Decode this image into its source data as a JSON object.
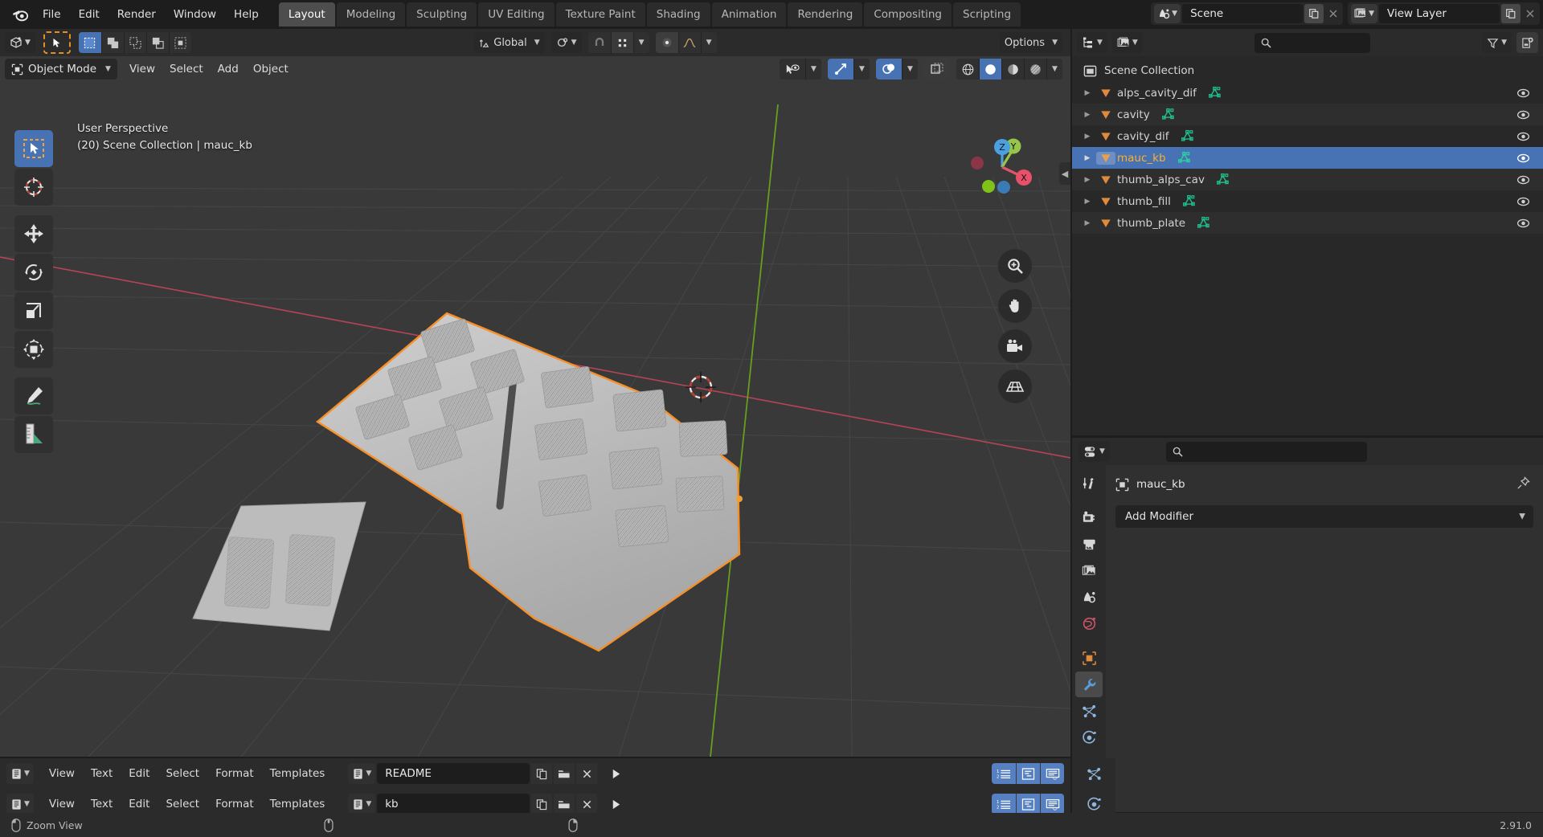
{
  "app": {
    "name": "Blender",
    "version": "2.91.0",
    "logo_icon": "blender-logo-icon"
  },
  "topbar": {
    "menus": [
      "File",
      "Edit",
      "Render",
      "Window",
      "Help"
    ],
    "workspace_tabs": [
      {
        "label": "Layout",
        "active": true
      },
      {
        "label": "Modeling",
        "active": false
      },
      {
        "label": "Sculpting",
        "active": false
      },
      {
        "label": "UV Editing",
        "active": false
      },
      {
        "label": "Texture Paint",
        "active": false
      },
      {
        "label": "Shading",
        "active": false
      },
      {
        "label": "Animation",
        "active": false
      },
      {
        "label": "Rendering",
        "active": false
      },
      {
        "label": "Compositing",
        "active": false
      },
      {
        "label": "Scripting",
        "active": false
      }
    ],
    "scene": {
      "icon": "scene-icon",
      "name": "Scene",
      "new_icon": "copy-icon",
      "unlink_icon": "x-icon"
    },
    "view_layer": {
      "icon": "view-layer-icon",
      "name": "View Layer",
      "new_icon": "copy-icon",
      "unlink_icon": "x-icon"
    }
  },
  "viewport": {
    "header": {
      "editor_type_icon": "editor-type-3dview-icon",
      "cursor_tool_icon": "tweak-cursor-icon",
      "select_modes": [
        {
          "icon": "select-set-icon",
          "active": true
        },
        {
          "icon": "select-extend-icon",
          "active": false
        },
        {
          "icon": "select-subtract-icon",
          "active": false
        },
        {
          "icon": "select-invert-icon",
          "active": false
        },
        {
          "icon": "select-intersect-icon",
          "active": false
        }
      ],
      "transform_orientation": {
        "icon": "orientation-global-icon",
        "label": "Global"
      },
      "pivot_icon": "pivot-point-icon",
      "snap_magnet_icon": "snap-magnet-icon",
      "snap_target_icon": "snap-target-icon",
      "proportional_edit_icon": "proportional-edit-icon",
      "proportional_falloff_icon": "falloff-smooth-icon",
      "options_label": "Options"
    },
    "header2": {
      "mode": {
        "icon": "object-mode-icon",
        "label": "Object Mode"
      },
      "menus": [
        "View",
        "Select",
        "Add",
        "Object"
      ],
      "visibility_icon": "show-hide-icon",
      "gizmo_icon": "gizmo-icon",
      "overlays_icon": "overlays-icon",
      "xray_icon": "xray-icon",
      "shading_modes": [
        {
          "icon": "shading-wireframe-icon",
          "active": false
        },
        {
          "icon": "shading-solid-icon",
          "active": true
        },
        {
          "icon": "shading-material-icon",
          "active": false
        },
        {
          "icon": "shading-rendered-icon",
          "active": false
        }
      ]
    },
    "overlay_text": {
      "line1": "User Perspective",
      "line2": "(20) Scene Collection | mauc_kb"
    },
    "toolbar": [
      {
        "icon": "tool-select-box-icon",
        "name": "tweak-select-box-tool",
        "active": true
      },
      {
        "icon": "tool-cursor-icon",
        "name": "cursor-tool",
        "active": false
      },
      {
        "icon": "tool-move-icon",
        "name": "move-tool",
        "active": false
      },
      {
        "icon": "tool-rotate-icon",
        "name": "rotate-tool",
        "active": false
      },
      {
        "icon": "tool-scale-icon",
        "name": "scale-tool",
        "active": false
      },
      {
        "icon": "tool-transform-icon",
        "name": "transform-tool",
        "active": false
      },
      {
        "icon": "tool-annotate-icon",
        "name": "annotate-tool",
        "active": false
      },
      {
        "icon": "tool-measure-icon",
        "name": "measure-tool",
        "active": false
      }
    ],
    "nav_gizmo": {
      "axes": [
        {
          "label": "X",
          "color": "#e0566a"
        },
        {
          "label": "Y",
          "color": "#97c54c"
        },
        {
          "label": "Z",
          "color": "#4ba0e0"
        }
      ]
    },
    "nav_buttons": [
      {
        "icon": "zoom-icon",
        "name": "zoom-view-button"
      },
      {
        "icon": "hand-icon",
        "name": "pan-view-button"
      },
      {
        "icon": "camera-icon",
        "name": "camera-view-button"
      },
      {
        "icon": "grid-perspective-icon",
        "name": "toggle-perspective-button"
      }
    ],
    "sidebar_toggle_icon": "chevron-left-icon"
  },
  "outliner": {
    "header": {
      "editor_type_icon": "editor-type-outliner-icon",
      "display_mode_icon": "display-mode-view-layer-icon",
      "search_placeholder": "",
      "filter_icon": "filter-funnel-icon",
      "new_collection_icon": "new-collection-icon"
    },
    "root": {
      "label": "Scene Collection",
      "icon": "collection-icon"
    },
    "items": [
      {
        "label": "alps_cavity_dif",
        "icon": "mesh-object-icon",
        "data_icon": "mesh-data-icon",
        "selected": false,
        "visible": true
      },
      {
        "label": "cavity",
        "icon": "mesh-object-icon",
        "data_icon": "mesh-data-icon",
        "selected": false,
        "visible": true
      },
      {
        "label": "cavity_dif",
        "icon": "mesh-object-icon",
        "data_icon": "mesh-data-icon",
        "selected": false,
        "visible": true
      },
      {
        "label": "mauc_kb",
        "icon": "mesh-object-icon",
        "data_icon": "mesh-data-icon",
        "selected": true,
        "visible": true
      },
      {
        "label": "thumb_alps_cav",
        "icon": "mesh-object-icon",
        "data_icon": "mesh-data-icon",
        "selected": false,
        "visible": true
      },
      {
        "label": "thumb_fill",
        "icon": "mesh-object-icon",
        "data_icon": "mesh-data-icon",
        "selected": false,
        "visible": true
      },
      {
        "label": "thumb_plate",
        "icon": "mesh-object-icon",
        "data_icon": "mesh-data-icon",
        "selected": false,
        "visible": true
      }
    ]
  },
  "properties": {
    "header": {
      "editor_type_icon": "editor-type-properties-icon",
      "search_placeholder": ""
    },
    "tabs": [
      {
        "icon": "tool-tab-icon",
        "name": "tool-properties-tab",
        "active": false
      },
      {
        "icon": "render-tab-icon",
        "name": "render-properties-tab",
        "active": false
      },
      {
        "icon": "output-tab-icon",
        "name": "output-properties-tab",
        "active": false
      },
      {
        "icon": "view-layer-tab-icon",
        "name": "view-layer-properties-tab",
        "active": false
      },
      {
        "icon": "scene-tab-icon",
        "name": "scene-properties-tab",
        "active": false
      },
      {
        "icon": "world-tab-icon",
        "name": "world-properties-tab",
        "active": false
      },
      {
        "icon": "object-tab-icon",
        "name": "object-properties-tab",
        "active": false
      },
      {
        "icon": "modifier-tab-icon",
        "name": "modifier-properties-tab",
        "active": true
      },
      {
        "icon": "particles-tab-icon",
        "name": "particle-properties-tab",
        "active": false
      },
      {
        "icon": "physics-tab-icon",
        "name": "physics-properties-tab",
        "active": false
      }
    ],
    "breadcrumb": {
      "icon": "object-icon",
      "label": "mauc_kb",
      "pin_icon": "pin-icon"
    },
    "add_modifier_label": "Add Modifier"
  },
  "text_editors": [
    {
      "editor_type_icon": "editor-type-text-icon",
      "menus": [
        "View",
        "Text",
        "Edit",
        "Select",
        "Format",
        "Templates"
      ],
      "datablock_icon": "text-datablock-icon",
      "filename": "README",
      "new_icon": "new-text-icon",
      "open_icon": "open-folder-icon",
      "unlink_icon": "x-icon",
      "run_icon": "run-script-icon",
      "toggles": [
        {
          "icon": "line-numbers-icon",
          "active": true
        },
        {
          "icon": "syntax-highlight-icon",
          "active": true
        },
        {
          "icon": "word-wrap-icon",
          "active": true
        }
      ],
      "edge_icon": "particles-tab-icon"
    },
    {
      "editor_type_icon": "editor-type-text-icon",
      "menus": [
        "View",
        "Text",
        "Edit",
        "Select",
        "Format",
        "Templates"
      ],
      "datablock_icon": "text-datablock-icon",
      "filename": "kb",
      "new_icon": "new-text-icon",
      "open_icon": "open-folder-icon",
      "unlink_icon": "x-icon",
      "run_icon": "run-script-icon",
      "toggles": [
        {
          "icon": "line-numbers-icon",
          "active": true
        },
        {
          "icon": "syntax-highlight-icon",
          "active": true
        },
        {
          "icon": "word-wrap-icon",
          "active": true
        }
      ],
      "edge_icon": "physics-tab-icon"
    }
  ],
  "statusbar": {
    "mouse_hint_icon": "mouse-left-icon",
    "mouse_hint_label": "Zoom View",
    "mouse_middle_icon": "mouse-middle-icon",
    "mouse_right_icon": "mouse-right-icon",
    "version": "2.91.0"
  },
  "colors": {
    "accent_blue": "#4772b3",
    "selected_text_orange": "#ffaf29",
    "object_icon_orange": "#e08a3c",
    "mesh_data_green": "#1fbf8f",
    "axis_x": "#e0566a",
    "axis_y": "#97c54c",
    "axis_z": "#4ba0e0",
    "viewport_bg": "#393939",
    "panel_bg": "#282828",
    "header_bg": "#2b2b2b",
    "outline_selected": "#f5902a"
  }
}
